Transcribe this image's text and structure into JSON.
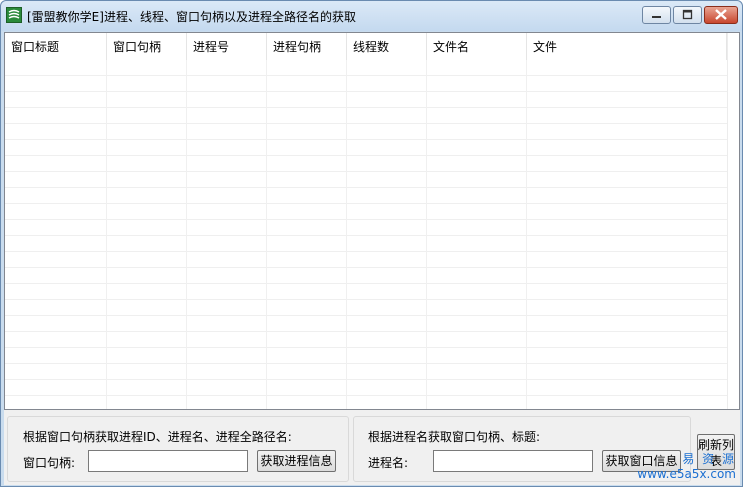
{
  "window": {
    "title": "[雷盟教你学E]进程、线程、窗口句柄以及进程全路径名的获取",
    "controls": {
      "minimize": "minimize",
      "maximize": "maximize",
      "close": "close"
    }
  },
  "listview": {
    "columns": [
      "窗口标题",
      "窗口句柄",
      "进程号",
      "进程句柄",
      "线程数",
      "文件名",
      "文件"
    ],
    "rows": []
  },
  "group_left": {
    "title": "根据窗口句柄获取进程ID、进程名、进程全路径名:",
    "field_label": "窗口句柄:",
    "field_value": "",
    "button": "获取进程信息"
  },
  "group_right": {
    "title": "根据进程名获取窗口句柄、标题:",
    "field_label": "进程名:",
    "field_value": "",
    "button": "获取窗口信息"
  },
  "refresh_button": "刷新列表",
  "watermark": {
    "line1": "易 资 源",
    "line2": "www.e5a5x.com"
  },
  "colors": {
    "titlebar": "#c4d9ef",
    "close_button": "#c8462e",
    "watermark": "#1b6fd1"
  }
}
